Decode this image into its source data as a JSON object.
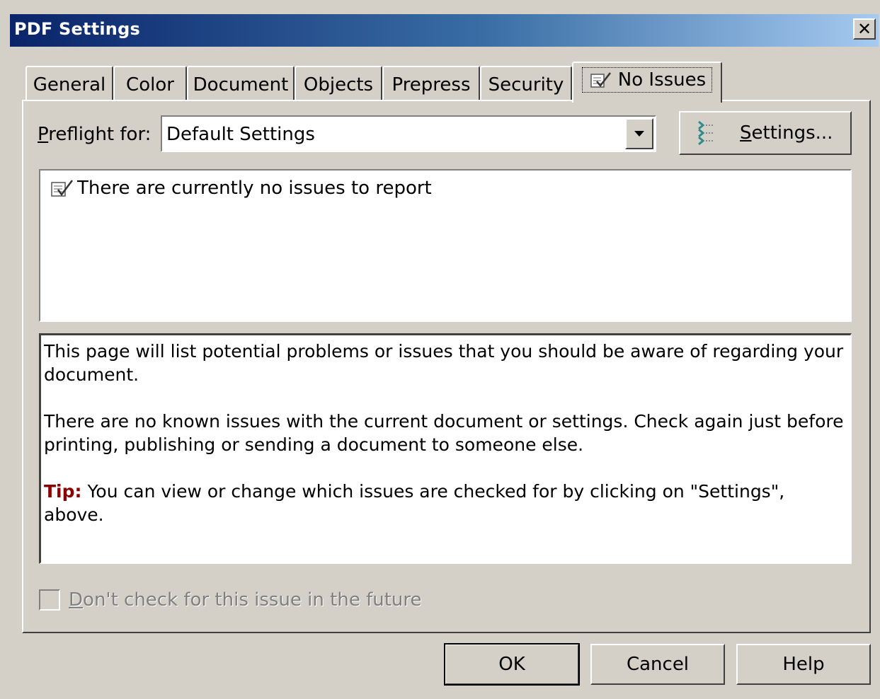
{
  "window": {
    "title": "PDF Settings",
    "close_label": "✕"
  },
  "tabs": [
    {
      "label": "General"
    },
    {
      "label": "Color"
    },
    {
      "label": "Document"
    },
    {
      "label": "Objects"
    },
    {
      "label": "Prepress"
    },
    {
      "label": "Security"
    },
    {
      "label": "No Issues",
      "icon": "checklist-icon",
      "active": true
    }
  ],
  "preflight": {
    "label_prefix": "P",
    "label_rest": "reflight for:",
    "selected": "Default Settings",
    "settings_prefix": "S",
    "settings_rest": "ettings..."
  },
  "issues": {
    "items": [
      {
        "icon": "checklist-icon",
        "text": "There are currently no issues to report"
      }
    ]
  },
  "description": {
    "paragraph1": "This page will list potential problems or issues that you should be aware of regarding your document.",
    "paragraph2": "There are no known issues with the current document or settings. Check again just before printing, publishing or sending a document to someone else.",
    "tip_label": "Tip:",
    "tip_text": " You can view or change which issues are checked for by clicking on \"Settings\", above."
  },
  "dont_check": {
    "label_prefix": "D",
    "label_rest": "on't check for this issue in the future",
    "checked": false,
    "enabled": false
  },
  "buttons": {
    "ok": "OK",
    "cancel": "Cancel",
    "help": "Help"
  },
  "colors": {
    "tip": "#8b0000",
    "titlebar_start": "#0a246a",
    "titlebar_end": "#a6caf0"
  }
}
